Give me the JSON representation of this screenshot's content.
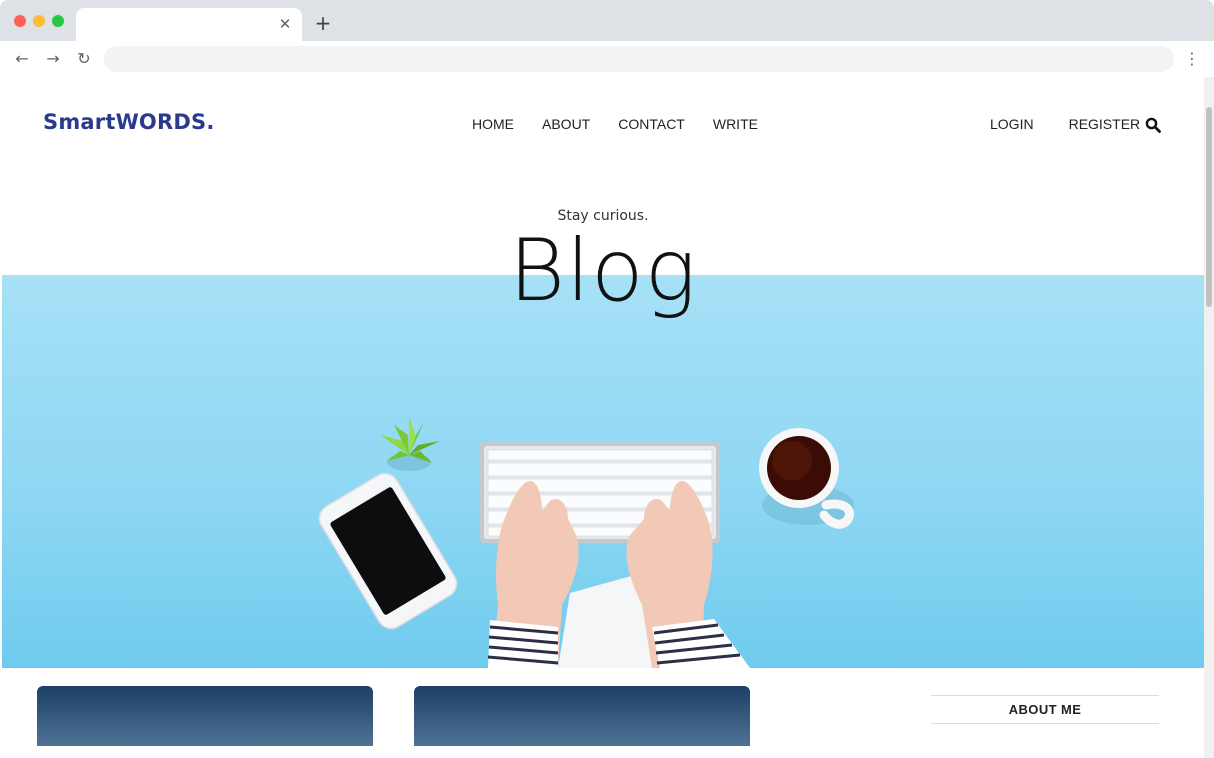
{
  "browser": {
    "tab": {
      "close_symbol": "✕"
    },
    "new_tab_symbol": "+",
    "toolbar": {
      "back_symbol": "←",
      "forward_symbol": "→",
      "reload_symbol": "↻",
      "menu_symbol": "⋮"
    }
  },
  "header": {
    "logo": "SmartWORDS.",
    "nav": [
      "HOME",
      "ABOUT",
      "CONTACT",
      "WRITE"
    ],
    "auth": [
      "LOGIN",
      "REGISTER"
    ],
    "search_icon": "search-icon"
  },
  "hero": {
    "subtitle": "Stay curious.",
    "title": "Blog"
  },
  "sidebar": {
    "about_title": "ABOUT ME"
  },
  "colors": {
    "logo": "#2a3a8c",
    "hero_bg": "#8fd7f3",
    "card_top": "#1e3f66"
  }
}
